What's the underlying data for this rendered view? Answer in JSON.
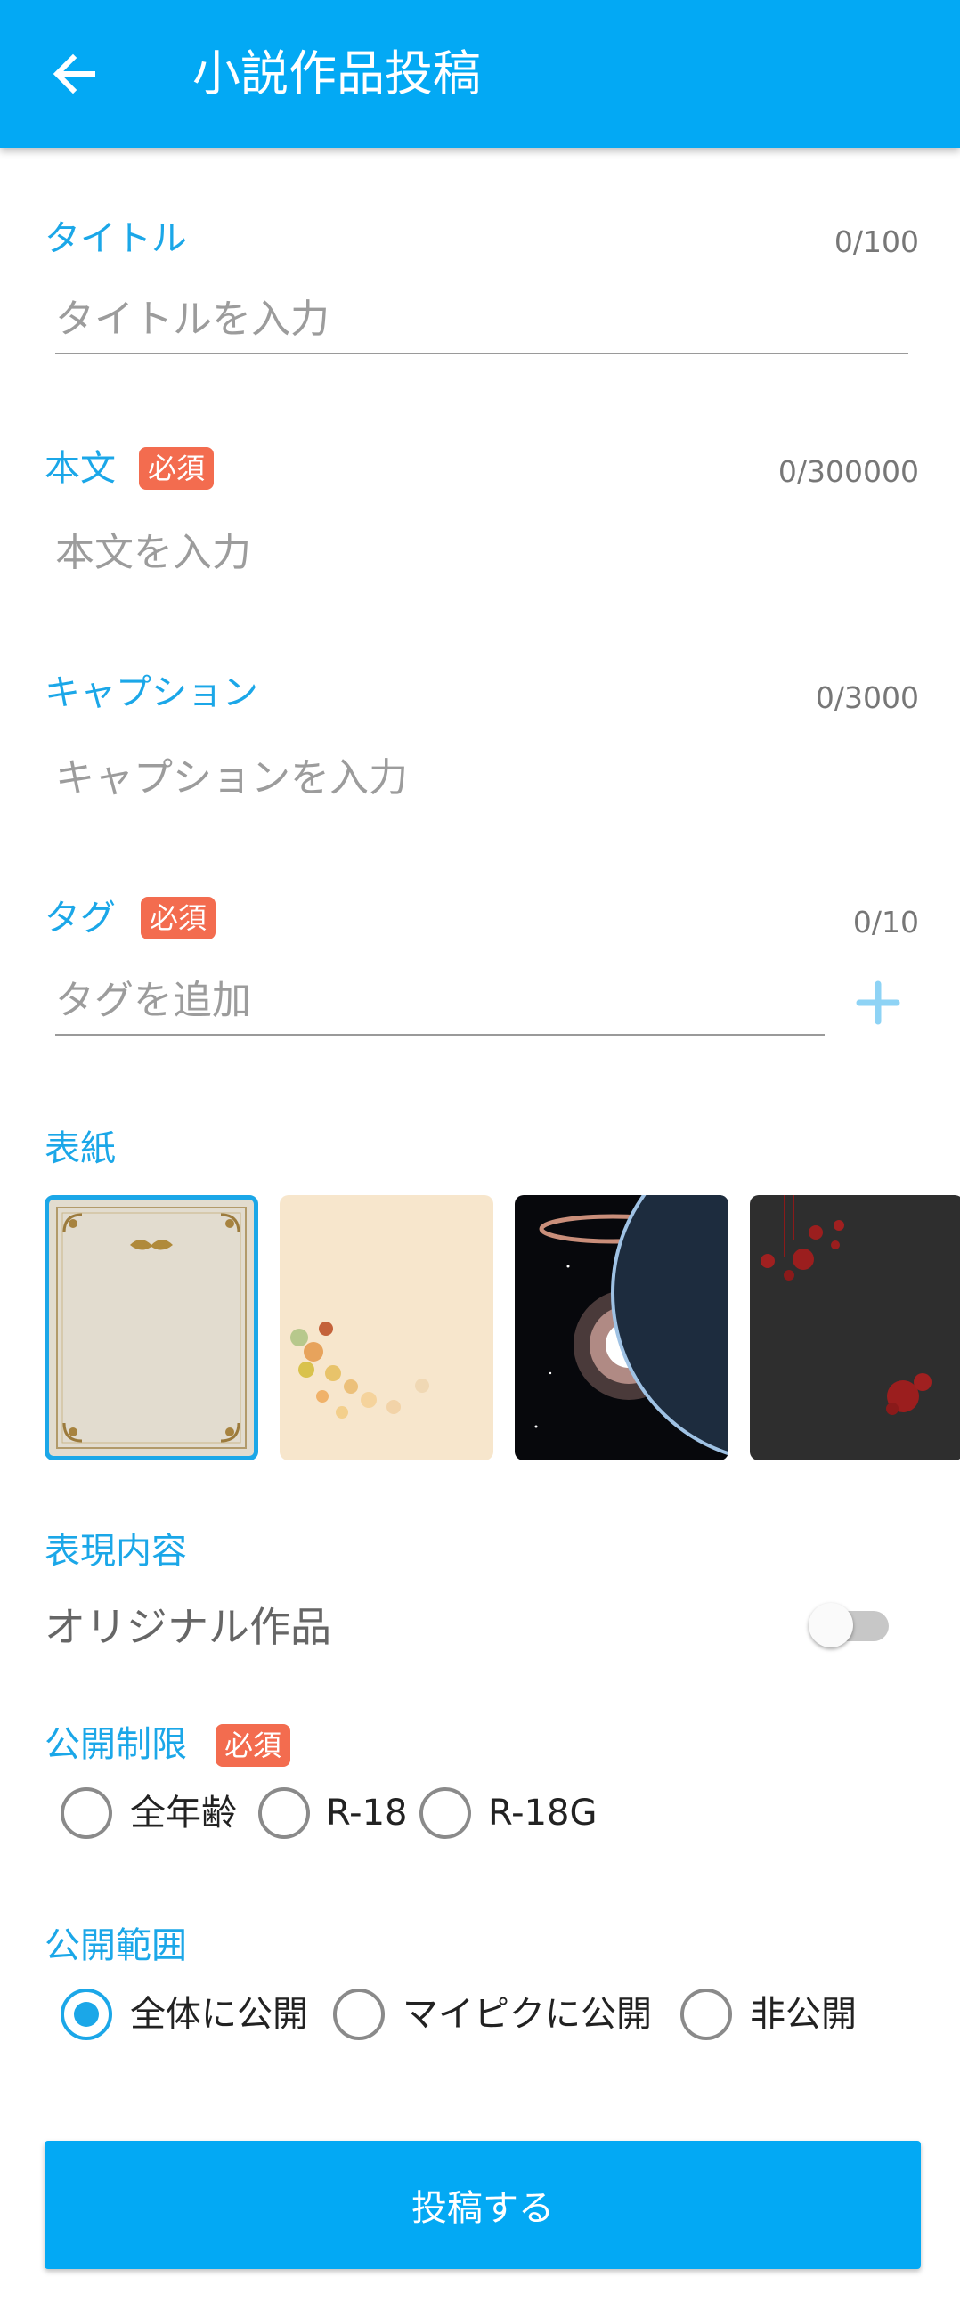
{
  "appbar": {
    "title": "小説作品投稿",
    "back_icon": "arrow-left-icon",
    "color": "#03a9f4"
  },
  "title_field": {
    "label": "タイトル",
    "counter": "0/100",
    "placeholder": "タイトルを入力"
  },
  "body_field": {
    "label": "本文",
    "required_badge": "必須",
    "counter": "0/300000",
    "placeholder": "本文を入力"
  },
  "caption_field": {
    "label": "キャプション",
    "counter": "0/3000",
    "placeholder": "キャプションを入力"
  },
  "tag_field": {
    "label": "タグ",
    "required_badge": "必須",
    "counter": "0/10",
    "placeholder": "タグを追加",
    "add_icon": "plus-icon"
  },
  "cover": {
    "label": "表紙",
    "options": [
      {
        "name": "parchment-ornate-cover",
        "selected": true
      },
      {
        "name": "autumn-leaves-cover",
        "selected": false
      },
      {
        "name": "space-planet-cover",
        "selected": false
      },
      {
        "name": "dark-red-splatter-cover",
        "selected": false
      }
    ]
  },
  "content": {
    "label": "表現内容",
    "original_label": "オリジナル作品",
    "original_on": false
  },
  "age_restriction": {
    "label": "公開制限",
    "required_badge": "必須",
    "options": [
      "全年齢",
      "R-18",
      "R-18G"
    ],
    "selected": null
  },
  "visibility": {
    "label": "公開範囲",
    "options": [
      "全体に公開",
      "マイピクに公開",
      "非公開"
    ],
    "selected": "全体に公開"
  },
  "submit": {
    "label": "投稿する"
  },
  "colors": {
    "accent": "#1ba7e8",
    "required_badge": "#f36c4f",
    "placeholder": "#9c9c9c"
  }
}
